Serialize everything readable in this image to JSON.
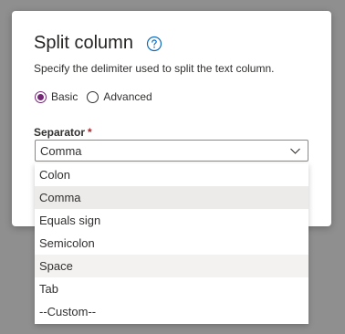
{
  "dialog": {
    "title": "Split column",
    "help_icon": "help-circle-icon",
    "subtitle": "Specify the delimiter used to split the text column.",
    "mode": {
      "options": [
        {
          "label": "Basic",
          "checked": true
        },
        {
          "label": "Advanced",
          "checked": false
        }
      ]
    },
    "separator": {
      "label": "Separator",
      "required_mark": "*",
      "value": "Comma",
      "expand_icon": "chevron-down-icon"
    }
  },
  "dropdown": {
    "options": [
      "Colon",
      "Comma",
      "Equals sign",
      "Semicolon",
      "Space",
      "Tab",
      "--Custom--"
    ],
    "selected": "Comma",
    "hovered": "Space"
  },
  "colors": {
    "accent": "#742774",
    "overlay": "#8f8f8f",
    "required": "#a4262c",
    "help_icon": "#0f6cbd"
  }
}
